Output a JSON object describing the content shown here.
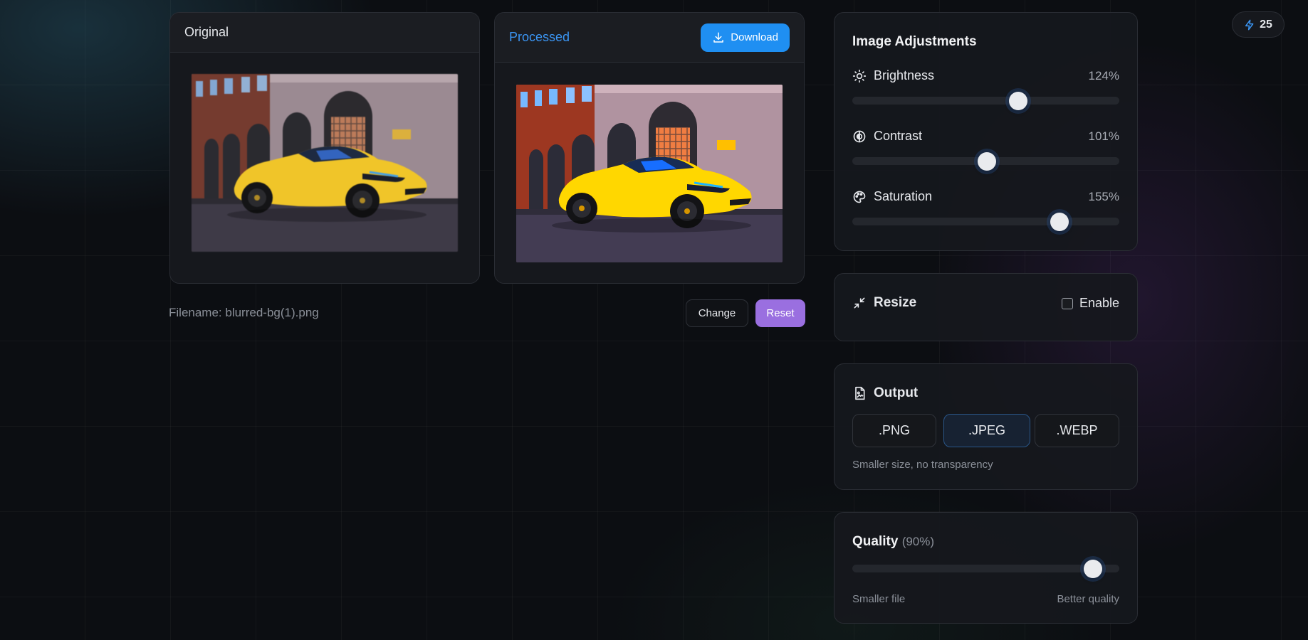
{
  "original_card": {
    "title": "Original"
  },
  "processed_card": {
    "title": "Processed",
    "download_label": "Download"
  },
  "file": {
    "label": "Filename:",
    "name": "blurred-bg(1).png"
  },
  "actions": {
    "change_label": "Change",
    "reset_label": "Reset"
  },
  "adjustments": {
    "title": "Image Adjustments",
    "sliders": [
      {
        "label": "Brightness",
        "value": "124%",
        "level": 0.62,
        "icon": "sun-icon"
      },
      {
        "label": "Contrast",
        "value": "101%",
        "level": 0.505,
        "icon": "contrast-icon"
      },
      {
        "label": "Saturation",
        "value": "155%",
        "level": 0.775,
        "icon": "palette-icon"
      }
    ]
  },
  "resize": {
    "title": "Resize",
    "enable_label": "Enable",
    "enabled": false,
    "icon": "shrink-arrows-icon"
  },
  "output": {
    "title": "Output",
    "icon": "image-file-icon",
    "formats": [
      ".PNG",
      ".JPEG",
      ".WEBP"
    ],
    "selected": ".JPEG",
    "hint": "Smaller size, no transparency"
  },
  "quality": {
    "title": "Quality",
    "value": "(90%)",
    "level": 0.9,
    "min_label": "Smaller file",
    "max_label": "Better quality"
  },
  "credits": {
    "count": "25",
    "icon": "lightning-icon"
  },
  "colors": {
    "accent": "#1f8ff2",
    "reset": "#9a6fe0",
    "processed_title": "#3b96f5",
    "car": "#f5c518"
  }
}
